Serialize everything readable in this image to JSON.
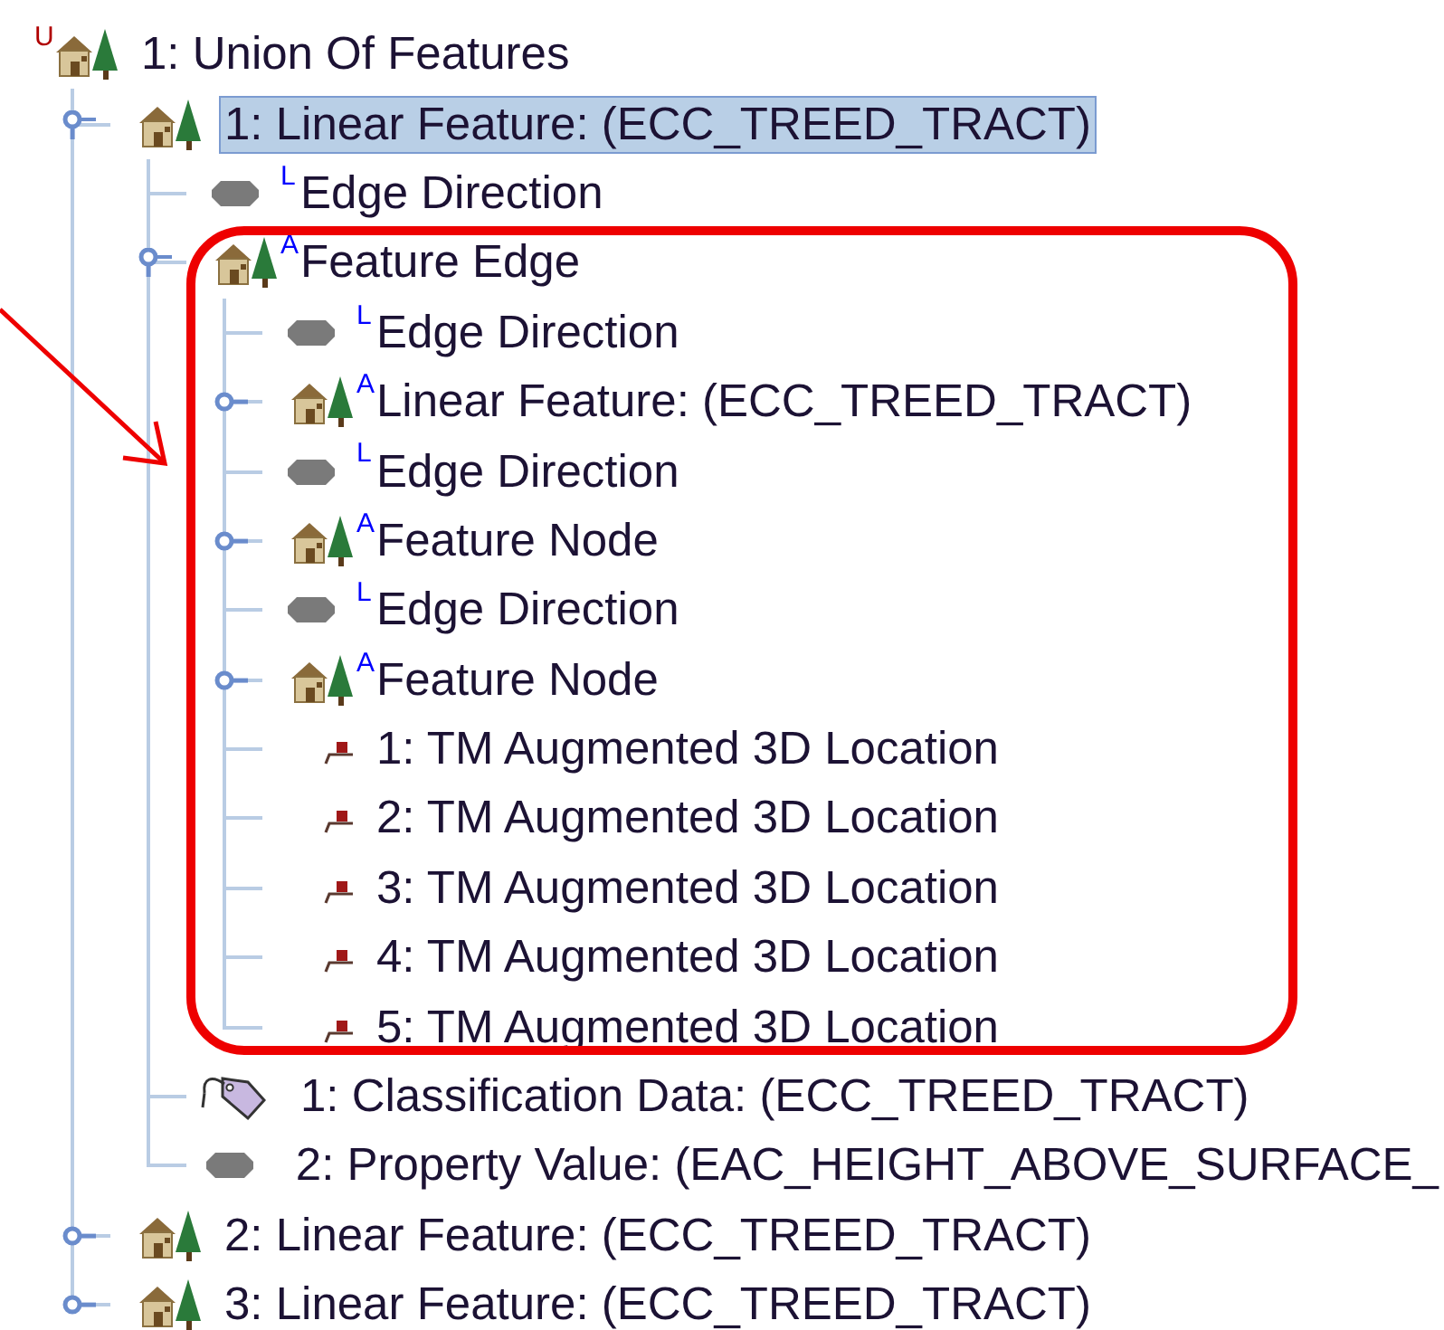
{
  "tree": [
    {
      "label": "1: Union Of Features",
      "kind": "feature",
      "badge": "U",
      "expanded": true,
      "selected": false,
      "children": [
        {
          "label": "1: Linear Feature: (ECC_TREED_TRACT)",
          "kind": "feature",
          "expanded": true,
          "selected": true,
          "children": [
            {
              "label": "Edge Direction",
              "kind": "oval",
              "badge": "L",
              "selected": false
            },
            {
              "label": "Feature Edge",
              "kind": "feature",
              "badge": "A",
              "expanded": true,
              "selected": false,
              "children": [
                {
                  "label": "Edge Direction",
                  "kind": "oval",
                  "badge": "L",
                  "selected": false
                },
                {
                  "label": "Linear Feature: (ECC_TREED_TRACT)",
                  "kind": "feature",
                  "badge": "A",
                  "expanded": false,
                  "selected": false
                },
                {
                  "label": "Edge Direction",
                  "kind": "oval",
                  "badge": "L",
                  "selected": false
                },
                {
                  "label": "Feature Node",
                  "kind": "feature",
                  "badge": "A",
                  "expanded": false,
                  "selected": false
                },
                {
                  "label": "Edge Direction",
                  "kind": "oval",
                  "badge": "L",
                  "selected": false
                },
                {
                  "label": "Feature Node",
                  "kind": "feature",
                  "badge": "A",
                  "expanded": false,
                  "selected": false
                },
                {
                  "label": "1: TM Augmented 3D Location",
                  "kind": "location",
                  "selected": false
                },
                {
                  "label": "2: TM Augmented 3D Location",
                  "kind": "location",
                  "selected": false
                },
                {
                  "label": "3: TM Augmented 3D Location",
                  "kind": "location",
                  "selected": false
                },
                {
                  "label": "4: TM Augmented 3D Location",
                  "kind": "location",
                  "selected": false
                },
                {
                  "label": "5: TM Augmented 3D Location",
                  "kind": "location",
                  "selected": false
                }
              ]
            },
            {
              "label": "1: Classification Data: (ECC_TREED_TRACT)",
              "kind": "tag",
              "selected": false
            },
            {
              "label": "2: Property Value: (EAC_HEIGHT_ABOVE_SURFACE_",
              "kind": "oval",
              "selected": false
            }
          ]
        },
        {
          "label": "2: Linear Feature: (ECC_TREED_TRACT)",
          "kind": "feature",
          "expanded": false,
          "selected": false
        },
        {
          "label": "3: Linear Feature: (ECC_TREED_TRACT)",
          "kind": "feature",
          "expanded": false,
          "selected": false
        }
      ]
    }
  ]
}
